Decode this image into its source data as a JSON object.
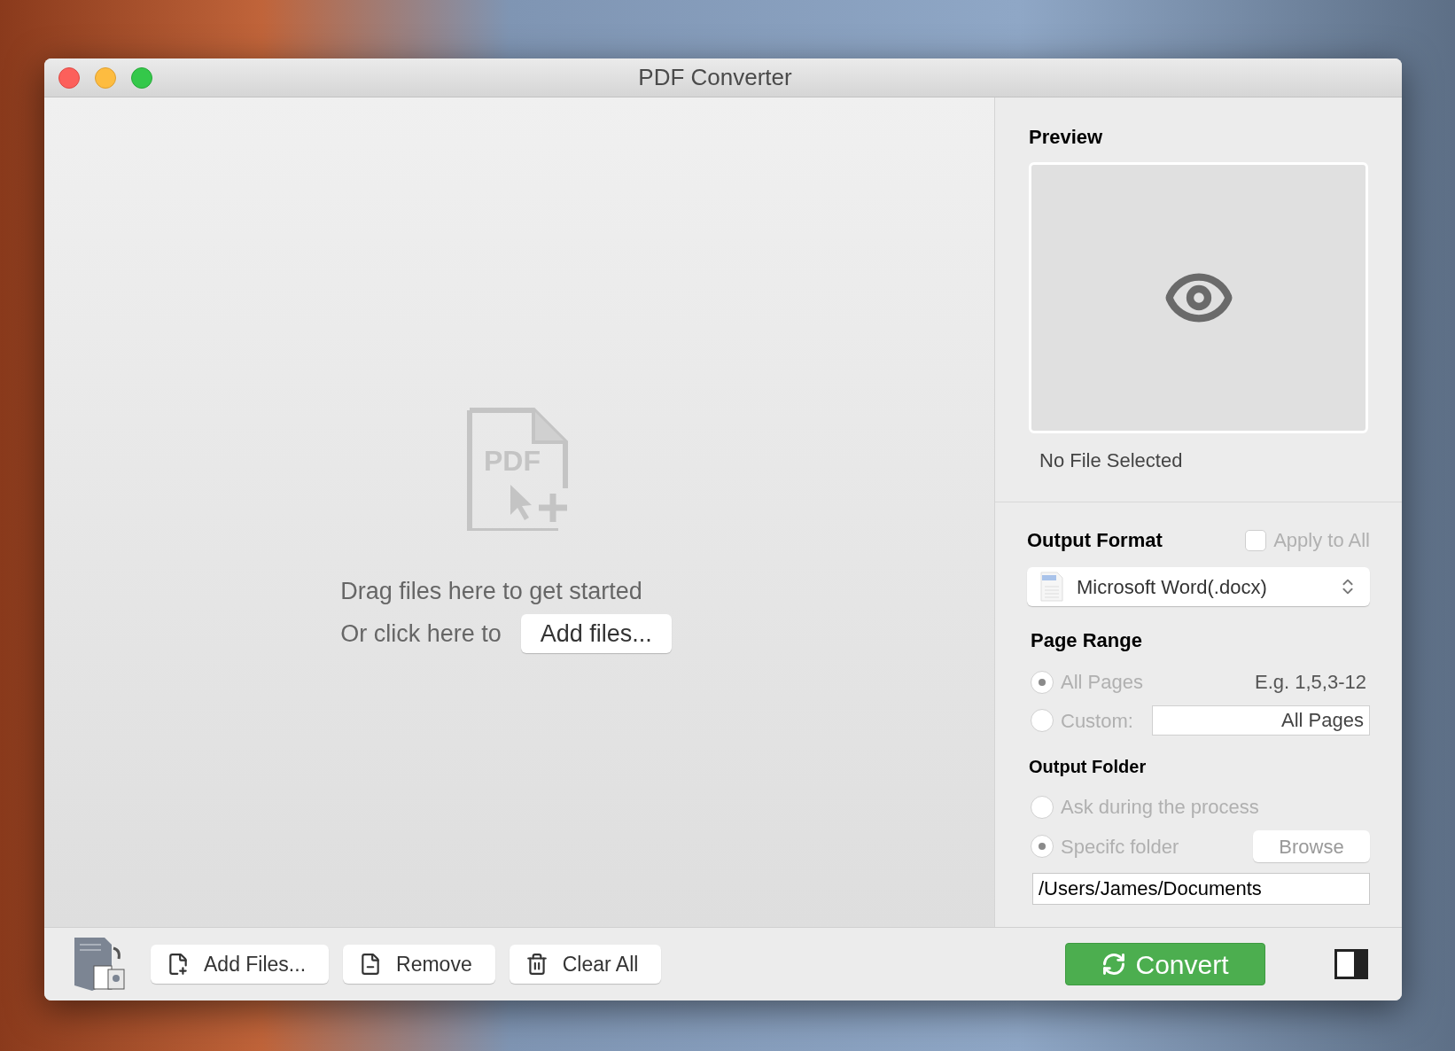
{
  "window": {
    "title": "PDF Converter"
  },
  "drop_zone": {
    "icon_text": "PDF",
    "message": "Drag files here to get started",
    "prompt": "Or click here to",
    "button": "Add files..."
  },
  "preview": {
    "heading": "Preview",
    "status": "No File Selected"
  },
  "output_format": {
    "heading": "Output Format",
    "apply_to_all": {
      "label": "Apply to All",
      "checked": false,
      "disabled": true
    },
    "value": "Microsoft Word(.docx)"
  },
  "page_range": {
    "heading": "Page Range",
    "hint": "E.g. 1,5,3-12",
    "options": [
      {
        "label": "All Pages",
        "selected": true,
        "disabled": true
      },
      {
        "label": "Custom:",
        "selected": false,
        "disabled": true
      }
    ],
    "custom_value": "All Pages"
  },
  "output_folder": {
    "heading": "Output Folder",
    "options": [
      {
        "label": "Ask during the process",
        "selected": false,
        "disabled": true
      },
      {
        "label": "Specifc folder",
        "selected": true,
        "disabled": true
      }
    ],
    "browse": "Browse",
    "path": "/Users/James/Documents"
  },
  "toolbar": {
    "buttons": [
      {
        "kind": "add",
        "label": "Add Files..."
      },
      {
        "kind": "remove",
        "label": "Remove"
      },
      {
        "kind": "clear",
        "label": "Clear All"
      }
    ],
    "convert": "Convert"
  }
}
